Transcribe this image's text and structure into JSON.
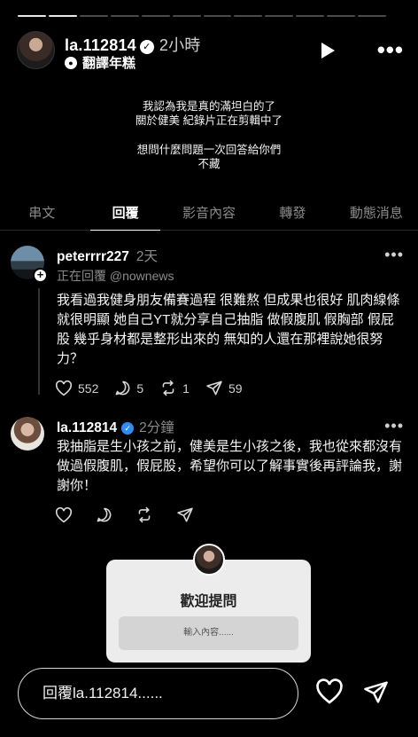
{
  "story": {
    "progress_total": 12,
    "progress_done": 2,
    "user": "la.112814",
    "verified_mark": "✓",
    "time": "2小時",
    "translate_label": "翻譯年糕",
    "text_lines": [
      "我認為我是真的滿坦白的了",
      "關於健美 紀錄片正在剪輯中了",
      "",
      "想問什麼問題一次回答給你們",
      "不藏"
    ]
  },
  "tabs": [
    {
      "label": "串文",
      "active": false
    },
    {
      "label": "回覆",
      "active": true
    },
    {
      "label": "影音內容",
      "active": false
    },
    {
      "label": "轉發",
      "active": false
    },
    {
      "label": "動態消息",
      "active": false
    }
  ],
  "comments": [
    {
      "user": "peterrrr227",
      "ago": "2天",
      "reply_to": "正在回覆 @nownews",
      "body": "我看過我健身朋友備賽過程 很難熬 但成果也很好 肌肉線條就很明顯 她自己YT就分享自己抽脂 做假腹肌 假胸部 假屁股 幾乎身材都是整形出來的 無知的人還在那裡說她很努力？",
      "likes": "552",
      "replies": "5",
      "reposts": "1",
      "shares": "59"
    },
    {
      "user": "la.112814",
      "ago": "2分鐘",
      "verified": true,
      "body": "我抽脂是生小孩之前，健美是生小孩之後，我也從來都沒有做過假腹肌，假屁股，希望你可以了解事實後再評論我，謝謝你！"
    }
  ],
  "card": {
    "title": "歡迎提問",
    "placeholder": "輸入內容......"
  },
  "bottom": {
    "reply_placeholder": "回覆la.112814......"
  },
  "icons": {
    "more": "•••",
    "comment_more": "•••"
  }
}
